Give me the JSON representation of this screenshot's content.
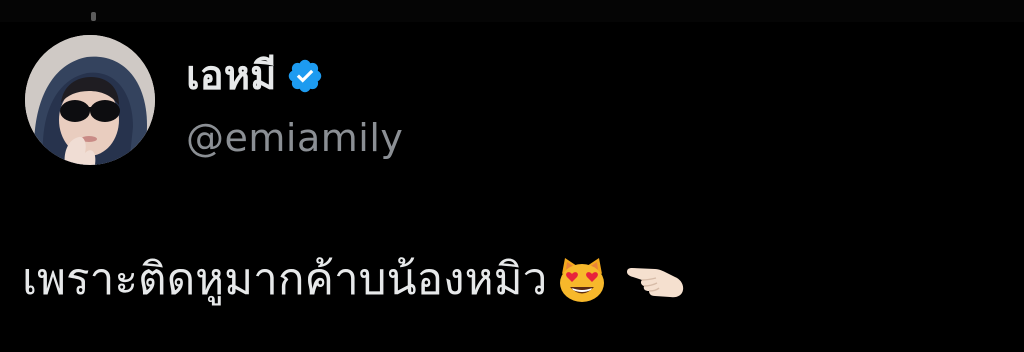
{
  "tweet": {
    "author": {
      "display_name": "เอหมี",
      "handle": "@emiamily",
      "verified": true,
      "verified_badge_icon": "verified-badge-icon",
      "avatar_icon": "avatar-photo"
    },
    "text": "เพราะติดหูมากค้าบน้องหมิว",
    "emojis": [
      "smiling-cat-heart-eyes-icon",
      "pointing-left-hand-icon"
    ]
  },
  "colors": {
    "background": "#000000",
    "text_primary": "#e7e9ea",
    "text_secondary": "#8b8f94",
    "verified_blue": "#1d9bf0"
  }
}
